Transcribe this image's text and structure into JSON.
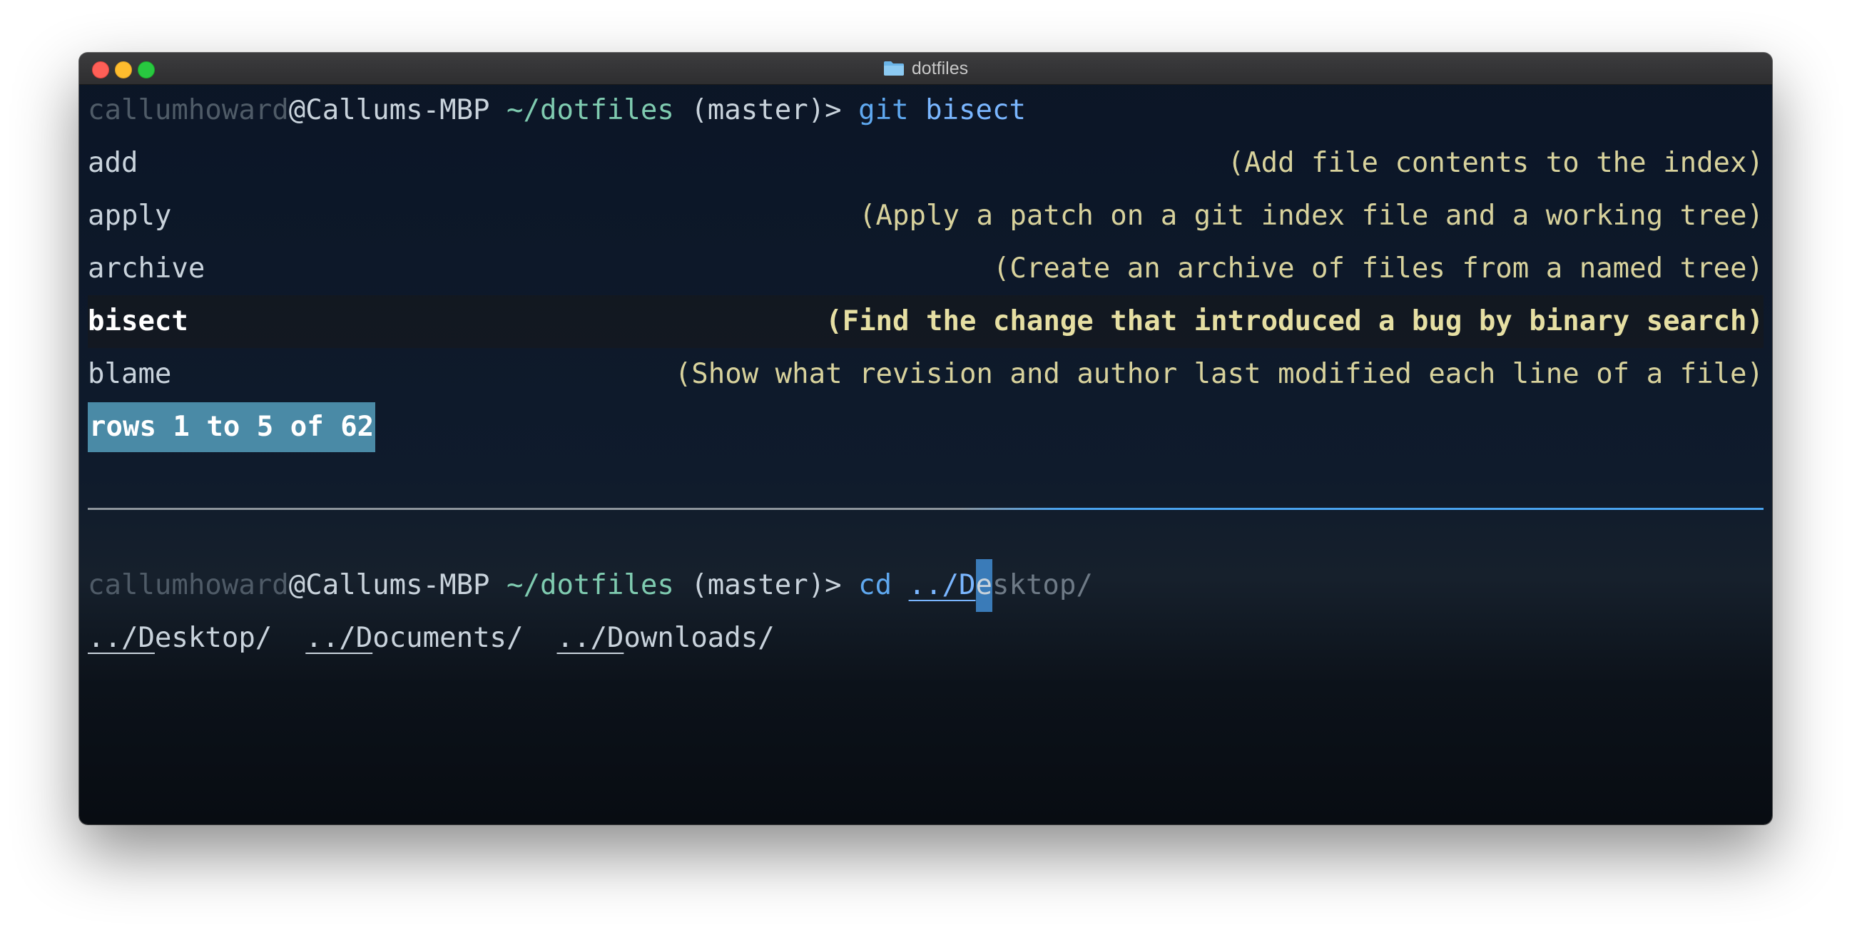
{
  "window": {
    "title": "dotfiles",
    "folder_icon": "folder-icon"
  },
  "prompt": {
    "user": "callumhoward",
    "host": "@Callums-MBP",
    "path": "~/dotfiles",
    "branch": "(master)>"
  },
  "command1": {
    "cmd": "git",
    "arg": "bisect"
  },
  "completions": [
    {
      "name": "add",
      "desc": "(Add file contents to the index)"
    },
    {
      "name": "apply",
      "desc": "(Apply a patch on a git index file and a working tree)"
    },
    {
      "name": "archive",
      "desc": "(Create an archive of files from a named tree)"
    },
    {
      "name": "bisect",
      "desc": "(Find the change that introduced a bug by binary search)",
      "selected": true
    },
    {
      "name": "blame",
      "desc": "(Show what revision and author last modified each line of a file)"
    }
  ],
  "pager": "rows 1 to 5 of 62",
  "command2": {
    "cmd": "cd",
    "typed": "../D",
    "cursor_char": "e",
    "autosuggest": "sktop/"
  },
  "dir_completions": [
    {
      "prefix": "../D",
      "rest": "esktop/"
    },
    {
      "prefix": "../D",
      "rest": "ocuments/"
    },
    {
      "prefix": "../D",
      "rest": "ownloads/"
    }
  ],
  "colors": {
    "accent_blue": "#4aa3ef",
    "pager_bg": "#4a8aa6",
    "desc_yellow": "#d8d29c",
    "path_green": "#7fcbb0"
  }
}
